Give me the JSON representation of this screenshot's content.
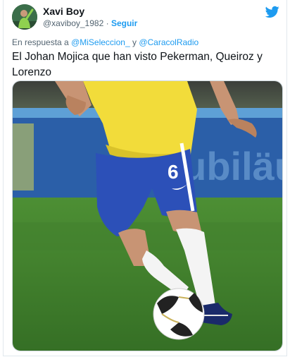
{
  "tweet": {
    "display_name": "Xavi Boy",
    "handle": "@xaviboy_1982",
    "separator": "·",
    "follow_label": "Seguir",
    "reply_prefix": "En respuesta a",
    "reply_mention_1": "@MiSeleccion_",
    "reply_joiner": "y",
    "reply_mention_2": "@CaracolRadio",
    "text": "El Johan Mojica que han visto Pekerman, Queiroz y Lorenzo"
  },
  "media": {
    "jersey_number": "6",
    "background_banner_text": "Jubiläum"
  },
  "colors": {
    "accent": "#1d9bf0",
    "jersey_yellow": "#f2dc3a",
    "shorts_blue": "#2c50b8",
    "pitch_green": "#3e7d2c"
  },
  "icons": {
    "brand": "twitter-bird-icon"
  }
}
